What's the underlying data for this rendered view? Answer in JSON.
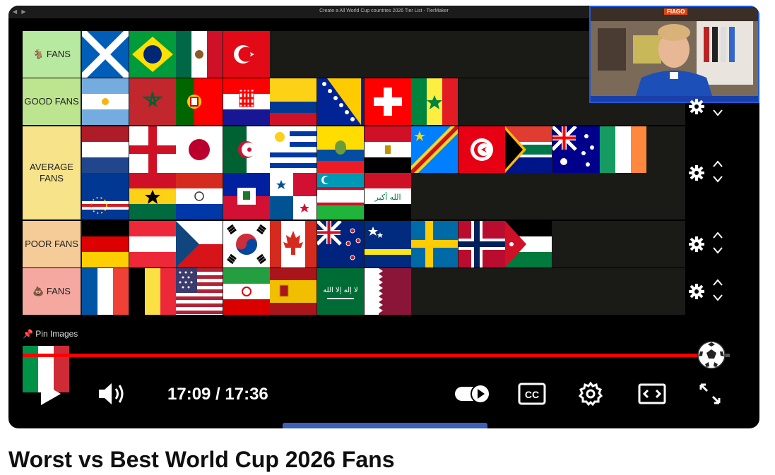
{
  "window": {
    "title": "Create a All World Cup countries 2026 Tier List - TierMaker"
  },
  "tiers": [
    {
      "label": "🐐 FANS",
      "color": "#b7e9a0",
      "flags": [
        "scotland",
        "brazil",
        "mexico",
        "turkey"
      ]
    },
    {
      "label": "GOOD FANS",
      "color": "#bde58f",
      "flags": [
        "argentina",
        "morocco",
        "portugal",
        "croatia",
        "colombia",
        "bosnia",
        "switzerland",
        "senegal"
      ]
    },
    {
      "label": "AVERAGE FANS",
      "color": "#f6e38a",
      "flags": [
        "netherlands",
        "england",
        "japan",
        "algeria",
        "uruguay",
        "ecuador",
        "egypt",
        "drcongo",
        "tunisia",
        "southafrica",
        "australia",
        "ireland",
        "capeverde",
        "ghana",
        "paraguay",
        "haiti",
        "panama",
        "uzbekistan",
        "iraq"
      ]
    },
    {
      "label": "POOR FANS",
      "color": "#f5cc97",
      "flags": [
        "germany",
        "austria",
        "czechia",
        "southkorea",
        "canada",
        "newzealand",
        "curacao",
        "sweden",
        "norway",
        "jordan"
      ]
    },
    {
      "label": "💩 FANS",
      "color": "#f4a8a0",
      "flags": [
        "france",
        "belgium",
        "usa",
        "iran",
        "spain",
        "saudi",
        "qatar"
      ]
    }
  ],
  "pin_images": {
    "label": "📌 Pin Images"
  },
  "player": {
    "current_time": "17:09",
    "duration": "17:36",
    "time_display": "17:09 / 17:36",
    "progress": 0.974,
    "play_icon": "play-icon",
    "volume_icon": "volume-icon",
    "autoplay_icon": "autoplay-toggle-icon",
    "cc_icon": "cc-icon",
    "settings_icon": "settings-gear-icon",
    "theater_icon": "theater-mode-icon",
    "fullscreen_icon": "fullscreen-icon"
  },
  "webcam": {
    "badge": "FIAGO"
  },
  "video": {
    "title": "Worst vs Best World Cup 2026 Fans"
  },
  "colors": {
    "progress": "#ff0000",
    "scrubber_bg": "#555555"
  }
}
